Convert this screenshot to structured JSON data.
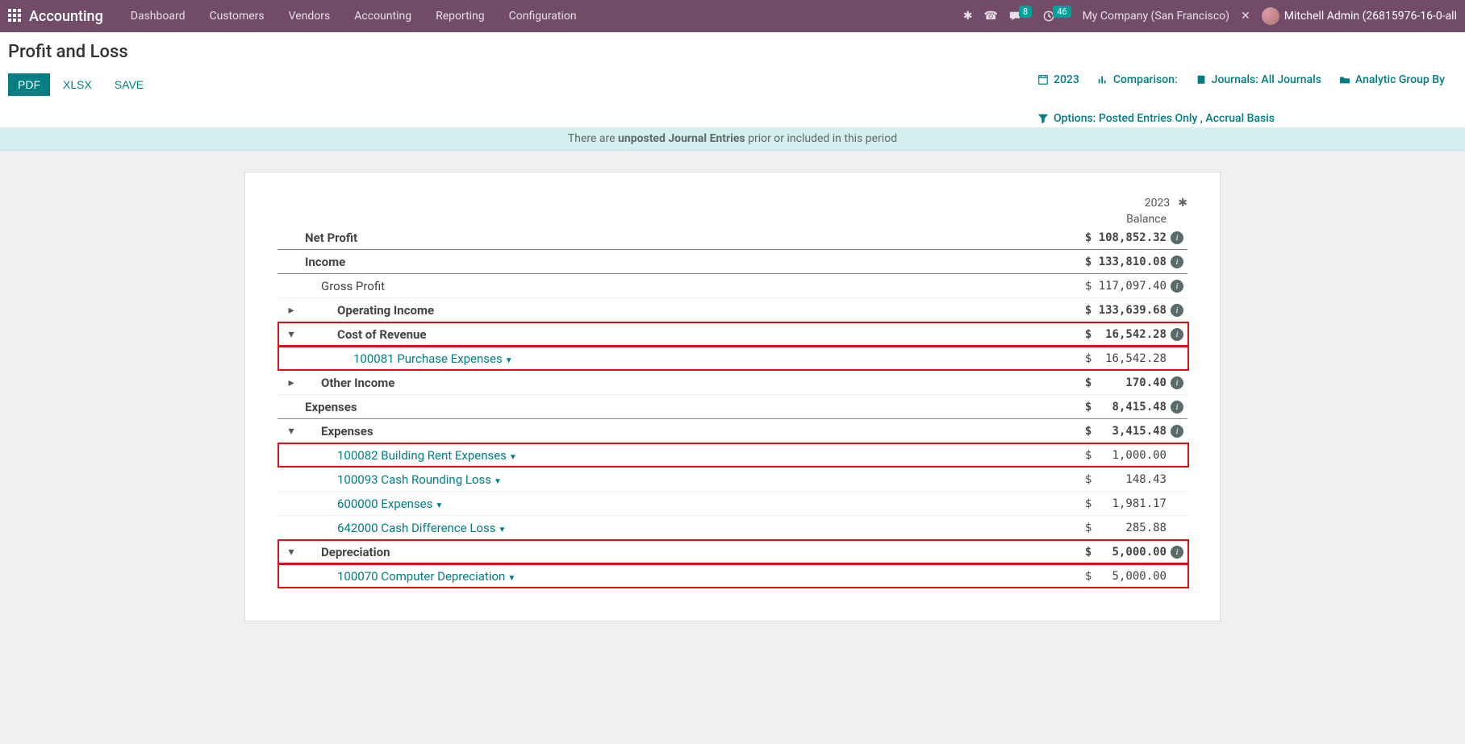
{
  "nav": {
    "brand": "Accounting",
    "items": [
      "Dashboard",
      "Customers",
      "Vendors",
      "Accounting",
      "Reporting",
      "Configuration"
    ],
    "company": "My Company (San Francisco)",
    "user": "Mitchell Admin (26815976-16-0-all",
    "msg_badge": "8",
    "activity_badge": "46"
  },
  "cp": {
    "title": "Profit and Loss",
    "buttons": {
      "pdf": "PDF",
      "xlsx": "XLSX",
      "save": "SAVE"
    },
    "filters": {
      "date": "2023",
      "comparison": "Comparison:",
      "journals_label": "Journals:",
      "journals_value": "All Journals",
      "analytic": "Analytic Group By",
      "options_label": "Options:",
      "options_value": "Posted Entries Only , Accrual Basis"
    }
  },
  "alert": {
    "pre": "There are ",
    "bold": "unposted Journal Entries",
    "post": " prior or included in this period"
  },
  "report": {
    "col_year": "2023",
    "col_sub": "Balance",
    "lines": [
      {
        "caret": "",
        "indent": 0,
        "label": "Net Profit",
        "link": false,
        "value": "$ 108,852.32",
        "bold": true,
        "info": true,
        "sec": true,
        "hl": false
      },
      {
        "caret": "",
        "indent": 0,
        "label": "Income",
        "link": false,
        "value": "$ 133,810.08",
        "bold": true,
        "info": true,
        "sec": true,
        "hl": false
      },
      {
        "caret": "",
        "indent": 1,
        "label": "Gross Profit",
        "link": false,
        "value": "$ 117,097.40",
        "bold": false,
        "info": true,
        "sec": false,
        "hl": false
      },
      {
        "caret": "▸",
        "indent": 2,
        "label": "Operating Income",
        "link": false,
        "value": "$ 133,639.68",
        "bold": true,
        "info": true,
        "sec": false,
        "hl": false
      },
      {
        "caret": "▾",
        "indent": 2,
        "label": "Cost of Revenue",
        "link": false,
        "value": "$  16,542.28",
        "bold": true,
        "info": true,
        "sec": false,
        "hl": true
      },
      {
        "caret": "",
        "indent": 3,
        "label": "100081 Purchase Expenses",
        "link": true,
        "value": "$  16,542.28",
        "bold": false,
        "info": false,
        "sec": false,
        "hl": true
      },
      {
        "caret": "▸",
        "indent": 1,
        "label": "Other Income",
        "link": false,
        "value": "$     170.40",
        "bold": true,
        "info": true,
        "sec": false,
        "hl": false
      },
      {
        "caret": "",
        "indent": 0,
        "label": "Expenses",
        "link": false,
        "value": "$   8,415.48",
        "bold": true,
        "info": true,
        "sec": true,
        "hl": false
      },
      {
        "caret": "▾",
        "indent": 1,
        "label": "Expenses",
        "link": false,
        "value": "$   3,415.48",
        "bold": true,
        "info": true,
        "sec": false,
        "hl": false
      },
      {
        "caret": "",
        "indent": 2,
        "label": "100082 Building Rent Expenses",
        "link": true,
        "value": "$   1,000.00",
        "bold": false,
        "info": false,
        "sec": false,
        "hl": true
      },
      {
        "caret": "",
        "indent": 2,
        "label": "100093 Cash Rounding Loss",
        "link": true,
        "value": "$     148.43",
        "bold": false,
        "info": false,
        "sec": false,
        "hl": false
      },
      {
        "caret": "",
        "indent": 2,
        "label": "600000 Expenses",
        "link": true,
        "value": "$   1,981.17",
        "bold": false,
        "info": false,
        "sec": false,
        "hl": false
      },
      {
        "caret": "",
        "indent": 2,
        "label": "642000 Cash Difference Loss",
        "link": true,
        "value": "$     285.88",
        "bold": false,
        "info": false,
        "sec": false,
        "hl": false
      },
      {
        "caret": "▾",
        "indent": 1,
        "label": "Depreciation",
        "link": false,
        "value": "$   5,000.00",
        "bold": true,
        "info": true,
        "sec": false,
        "hl": true
      },
      {
        "caret": "",
        "indent": 2,
        "label": "100070 Computer Depreciation",
        "link": true,
        "value": "$   5,000.00",
        "bold": false,
        "info": false,
        "sec": false,
        "hl": true
      }
    ]
  }
}
